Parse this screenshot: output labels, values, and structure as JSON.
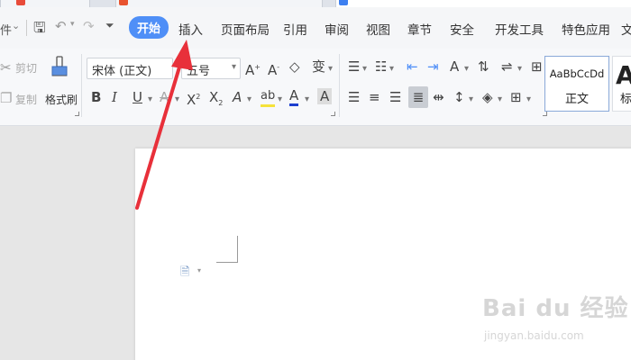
{
  "quick_access": {
    "file_label": "件",
    "menu_toggle_label": "≡"
  },
  "menu_tabs": [
    "开始",
    "插入",
    "页面布局",
    "引用",
    "审阅",
    "视图",
    "章节",
    "安全",
    "开发工具",
    "特色应用",
    "文"
  ],
  "clipboard": {
    "cut_label": "剪切",
    "copy_label": "复制",
    "format_painter_label": "格式刷"
  },
  "font": {
    "family_value": "宋体 (正文)",
    "size_value": "五号"
  },
  "styles": {
    "items": [
      {
        "sample": "AaBbCcDd",
        "name": "正文"
      },
      {
        "sample": "Aa",
        "name": "标"
      }
    ]
  },
  "watermark": {
    "brand": "Bai du 经验",
    "site": "jingyan.baidu.com"
  },
  "colors": {
    "accent": "#4f8ff7",
    "annotation_arrow": "#e8303a",
    "highlight": "#f5e23a",
    "font_color": "#1d3fcf"
  }
}
